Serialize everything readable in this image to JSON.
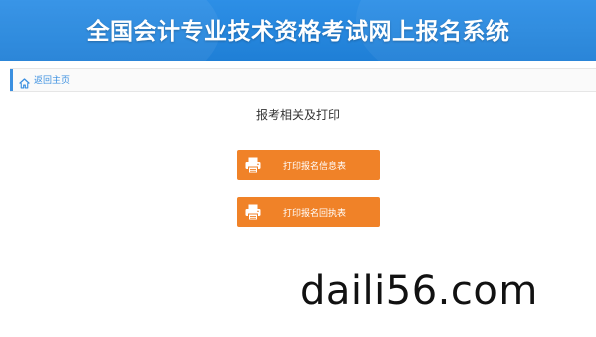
{
  "header": {
    "title": "全国会计专业技术资格考试网上报名系统"
  },
  "breadcrumb": {
    "home_label": "返回主页",
    "home_icon": "home-icon"
  },
  "main": {
    "section_title": "报考相关及打印",
    "buttons": [
      {
        "label": "打印报名信息表",
        "icon": "printer-icon"
      },
      {
        "label": "打印报名回执表",
        "icon": "printer-icon"
      }
    ]
  },
  "watermark": {
    "text": "daili56.com"
  },
  "colors": {
    "header_blue": "#1f7fd6",
    "button_orange": "#f08228",
    "link_blue": "#3a8fe0"
  }
}
